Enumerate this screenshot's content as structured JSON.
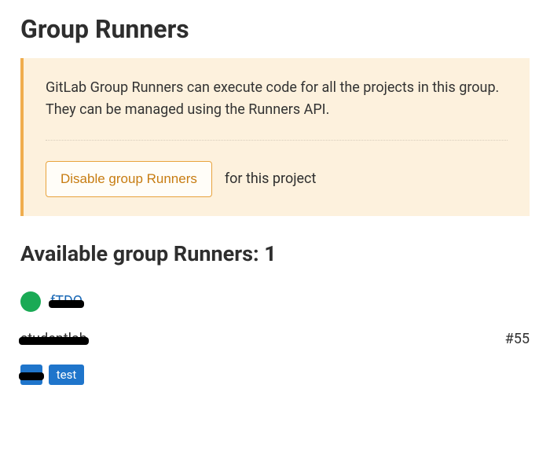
{
  "page": {
    "title": "Group Runners"
  },
  "info_panel": {
    "description": "GitLab Group Runners can execute code for all the projects in this group. They can be managed using the Runners API.",
    "disable_button": "Disable group Runners",
    "suffix": "for this project"
  },
  "available": {
    "heading": "Available group Runners: 1"
  },
  "runner": {
    "status": "online",
    "token": "fTDQ",
    "description": "studentlab",
    "id": "#55",
    "tags": [
      "s",
      "test"
    ]
  }
}
